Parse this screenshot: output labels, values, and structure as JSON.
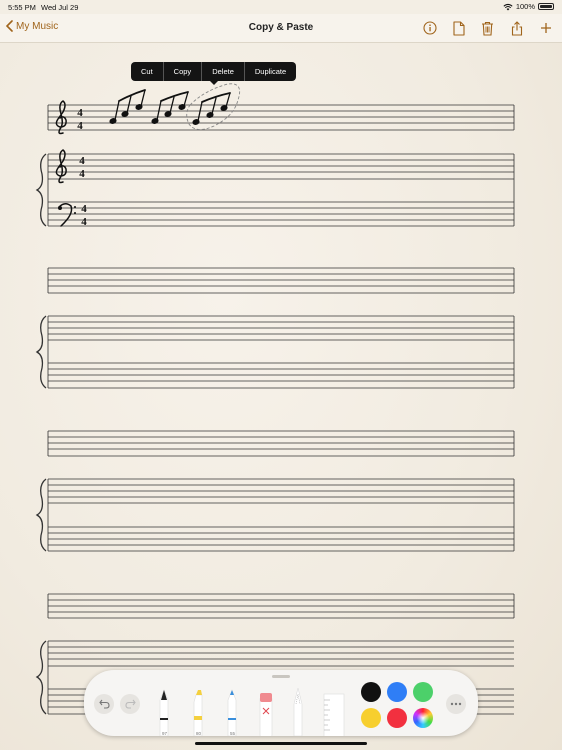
{
  "status_bar": {
    "time": "5:55 PM",
    "date": "Wed Jul 29",
    "battery": "100%"
  },
  "nav": {
    "back_label": "My Music",
    "title": "Copy & Paste",
    "actions": [
      "info-icon",
      "new-page-icon",
      "trash-icon",
      "share-icon",
      "add-icon"
    ]
  },
  "context_menu": {
    "items": [
      "Cut",
      "Copy",
      "Delete",
      "Duplicate"
    ]
  },
  "score": {
    "time_signature": {
      "top": "4",
      "bottom": "4"
    },
    "systems": 4
  },
  "toolbar": {
    "tools": [
      {
        "name": "pen",
        "width_label": "97"
      },
      {
        "name": "marker",
        "width_label": "80",
        "color": "#f4d03f"
      },
      {
        "name": "pencil",
        "width_label": "55",
        "color": "#3a8fdc"
      },
      {
        "name": "eraser"
      },
      {
        "name": "lasso"
      },
      {
        "name": "ruler"
      }
    ],
    "colors": [
      "#111111",
      "#2f7ef6",
      "#4cd06a",
      "#f7cf2e",
      "#f2303f",
      "multicolor"
    ]
  },
  "colors": {
    "accent": "#a0641b"
  }
}
